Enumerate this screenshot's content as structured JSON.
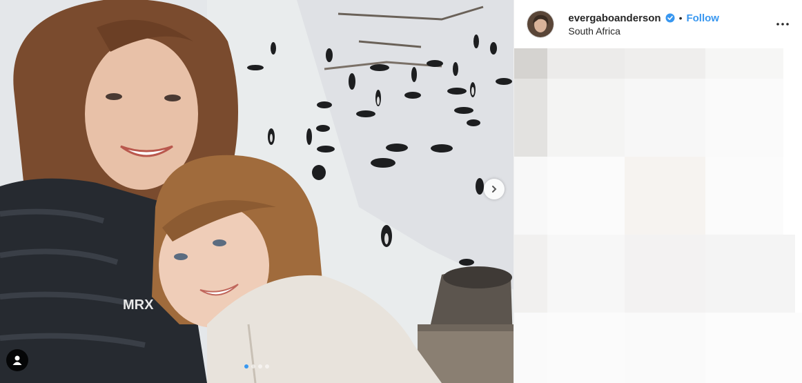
{
  "post": {
    "username": "evergaboanderson",
    "follow_label": "Follow",
    "separator": "•",
    "location": "South Africa",
    "verified": true
  },
  "media": {
    "brand_text": "MRX",
    "carousel_count": 4,
    "active_index": 0
  },
  "icons": {
    "verified": "verified-badge-icon",
    "more": "more-options-icon",
    "next": "chevron-right-icon",
    "user_tag": "user-tag-icon"
  },
  "colors": {
    "accent": "#3897f0",
    "text": "#262626"
  }
}
